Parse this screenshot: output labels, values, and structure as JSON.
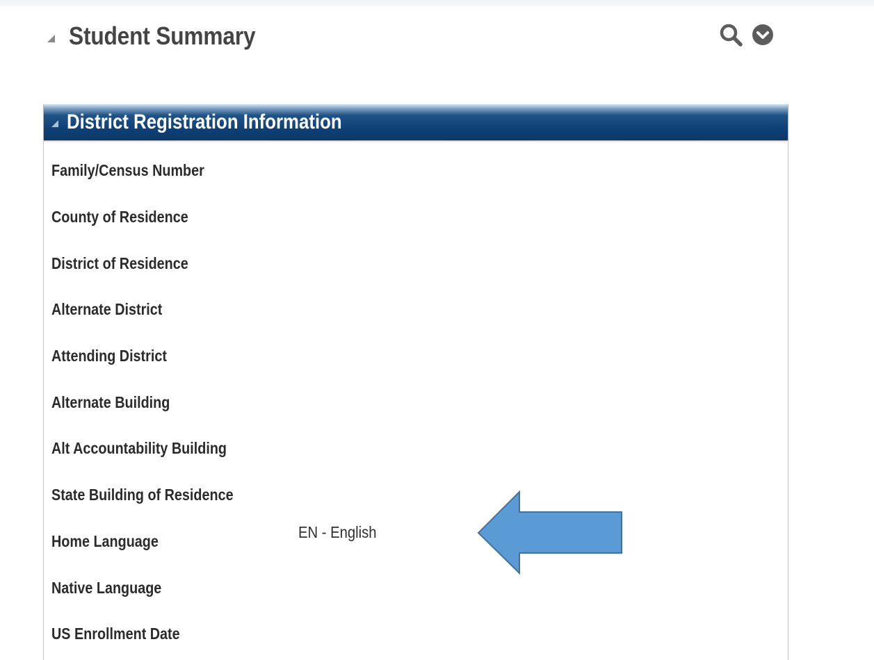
{
  "page": {
    "title": "Student Summary"
  },
  "header_tools": {
    "icons": [
      "search-icon",
      "chevron-down-circle-icon"
    ]
  },
  "section": {
    "title": "District Registration Information",
    "header_color": "#0d3f74",
    "fields": [
      {
        "label": "Family/Census Number",
        "value": ""
      },
      {
        "label": "County of Residence",
        "value": ""
      },
      {
        "label": "District of Residence",
        "value": ""
      },
      {
        "label": "Alternate District",
        "value": ""
      },
      {
        "label": "Attending District",
        "value": ""
      },
      {
        "label": "Alternate Building",
        "value": ""
      },
      {
        "label": "Alt Accountability Building",
        "value": ""
      },
      {
        "label": "State Building of Residence",
        "value": ""
      },
      {
        "label": "Home Language",
        "value": "EN - English"
      },
      {
        "label": "Native Language",
        "value": ""
      },
      {
        "label": "US Enrollment Date",
        "value": ""
      }
    ]
  },
  "annotation": {
    "shape": "left-arrow",
    "fill_color": "#5b9bd5",
    "stroke_color": "#41719c"
  }
}
